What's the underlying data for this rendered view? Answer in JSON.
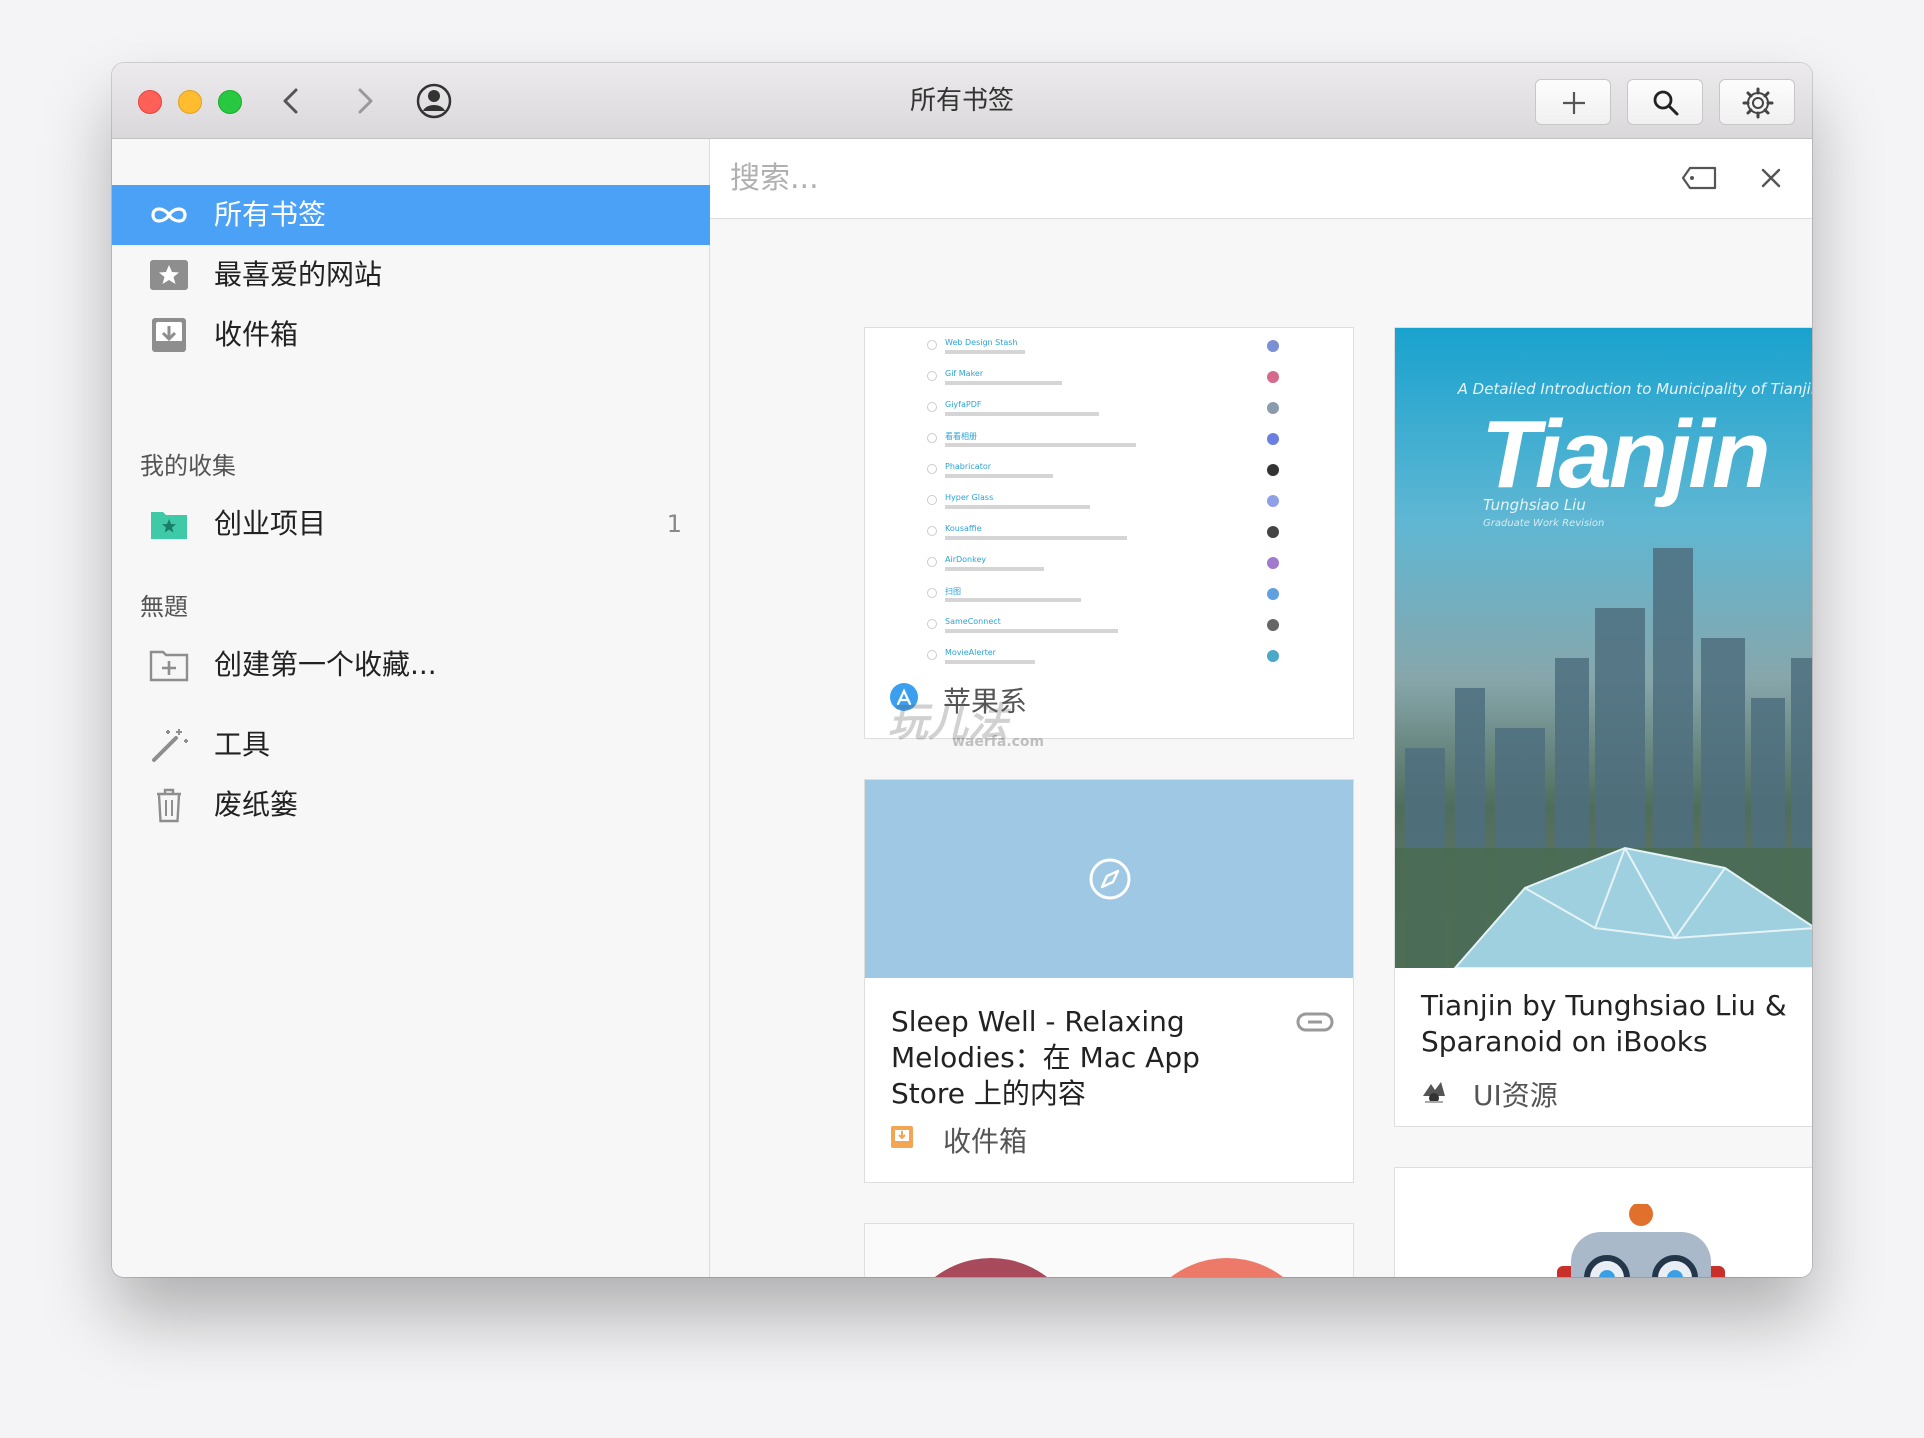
{
  "window": {
    "title": "所有书签"
  },
  "sidebar": {
    "items": [
      {
        "label": "所有书签",
        "icon": "infinity-icon"
      },
      {
        "label": "最喜爱的网站",
        "icon": "star-icon"
      },
      {
        "label": "收件箱",
        "icon": "inbox-icon"
      }
    ],
    "collections_title": "我的收集",
    "collections": [
      {
        "label": "创业项目",
        "count": "1",
        "icon": "folder-star-icon"
      }
    ],
    "untitled_title": "無題",
    "create_label": "创建第一个收藏...",
    "tools_label": "工具",
    "trash_label": "废纸篓"
  },
  "search": {
    "placeholder": "搜索..."
  },
  "cards": [
    {
      "title": "",
      "meta": "苹果系",
      "meta_icon": "app-store-icon",
      "list_lines": [
        "Web Design Stash",
        "Gif Maker",
        "GiyfaPDF",
        "看看相册",
        "Phabricator",
        "Hyper Glass",
        "Kousaffie",
        "AirDonkey",
        "扫图",
        "SameConnect",
        "MovieAlerter"
      ]
    },
    {
      "title": "Sleep Well - Relaxing Melodies：在 Mac App Store 上的内容",
      "title_lines": [
        "Sleep Well - Relaxing",
        "Melodies：在 Mac App",
        "Store 上的内容"
      ],
      "meta": "收件箱",
      "meta_icon": "inbox-icon"
    },
    {
      "title": "Tianjin by Tunghsiao Liu & Sparanoid on iBooks",
      "title_lines": [
        "Tianjin by Tunghsiao Liu &",
        "Sparanoid on iBooks"
      ],
      "meta": "UI资源",
      "meta_icon": "ui-resource-icon",
      "cover_subtitle": "A Detailed Introduction to Municipality of Tianjin",
      "cover_title": "Tianjin",
      "cover_author": "Tunghsiao Liu",
      "cover_note": "Graduate Work Revision"
    }
  ],
  "watermark": {
    "text": "玩儿法",
    "url": "waerfa.com"
  },
  "colors": {
    "accent": "#4aa1f6",
    "safari_thumb": "#9ec8e4",
    "circle_dark": "#a84a5b",
    "circle_light": "#ed7a68"
  }
}
